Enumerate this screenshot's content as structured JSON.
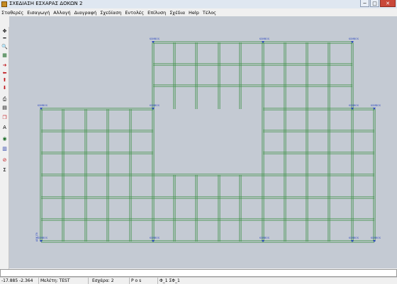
{
  "window": {
    "title": "ΣΧΕΔΙΑΣΗ ΕΣΧΑΡΑΣ ΔΟΚΩΝ 2",
    "min": "─",
    "max": "□",
    "close": "✕"
  },
  "menu": [
    "Σταθερές",
    "Εισαγωγή",
    "Αλλαγή",
    "Διαγραφή",
    "Σχεδίαση",
    "Εντολές",
    "Επίλυση",
    "Σχέδια",
    "Help",
    "Τέλος"
  ],
  "toolbar": [
    {
      "icon": "crosshair-icon",
      "glyph": "✥",
      "color": "#000000"
    },
    {
      "icon": "line-icon",
      "glyph": "━",
      "color": "#000000"
    },
    {
      "icon": "zoom-icon",
      "glyph": "🔍",
      "color": "#000000"
    },
    {
      "icon": "grid-icon",
      "glyph": "▦",
      "color": "#1f6d2a"
    },
    {
      "icon": "arrow-right-icon",
      "glyph": "➜",
      "color": "#c0161b"
    },
    {
      "icon": "arrow-left-icon",
      "glyph": "⬅",
      "color": "#c0161b"
    },
    {
      "icon": "arrow-up-icon",
      "glyph": "⬆",
      "color": "#c0161b"
    },
    {
      "icon": "arrow-down-icon",
      "glyph": "⬇",
      "color": "#c0161b"
    },
    {
      "icon": "printer-icon",
      "glyph": "⎙",
      "color": "#000000"
    },
    {
      "icon": "document-icon",
      "glyph": "▤",
      "color": "#000000"
    },
    {
      "icon": "copy-icon",
      "glyph": "❐",
      "color": "#c0161b"
    },
    {
      "icon": "text-icon",
      "glyph": "A",
      "color": "#000000"
    },
    {
      "icon": "globe-icon",
      "glyph": "◉",
      "color": "#1f6d2a"
    },
    {
      "icon": "chart-icon",
      "glyph": "▥",
      "color": "#2a3fa8"
    },
    {
      "icon": "circle-icon",
      "glyph": "⊘",
      "color": "#c0161b"
    },
    {
      "icon": "sigma-icon",
      "glyph": "Σ",
      "color": "#000000"
    }
  ],
  "drawing": {
    "beam_color": "#3a8f43",
    "support_color": "#2a45c0",
    "support_label": "KOMBOS",
    "side_note": "ΔΟΚ_ΠΛ"
  },
  "command_line": "",
  "status": {
    "coords": "-17.885 -2.364",
    "project": "Μελέτη: TEST",
    "grid": "Εσχάρα: 2",
    "pos": "P o s",
    "phi": "Φ_1  ΣΦ_1"
  }
}
